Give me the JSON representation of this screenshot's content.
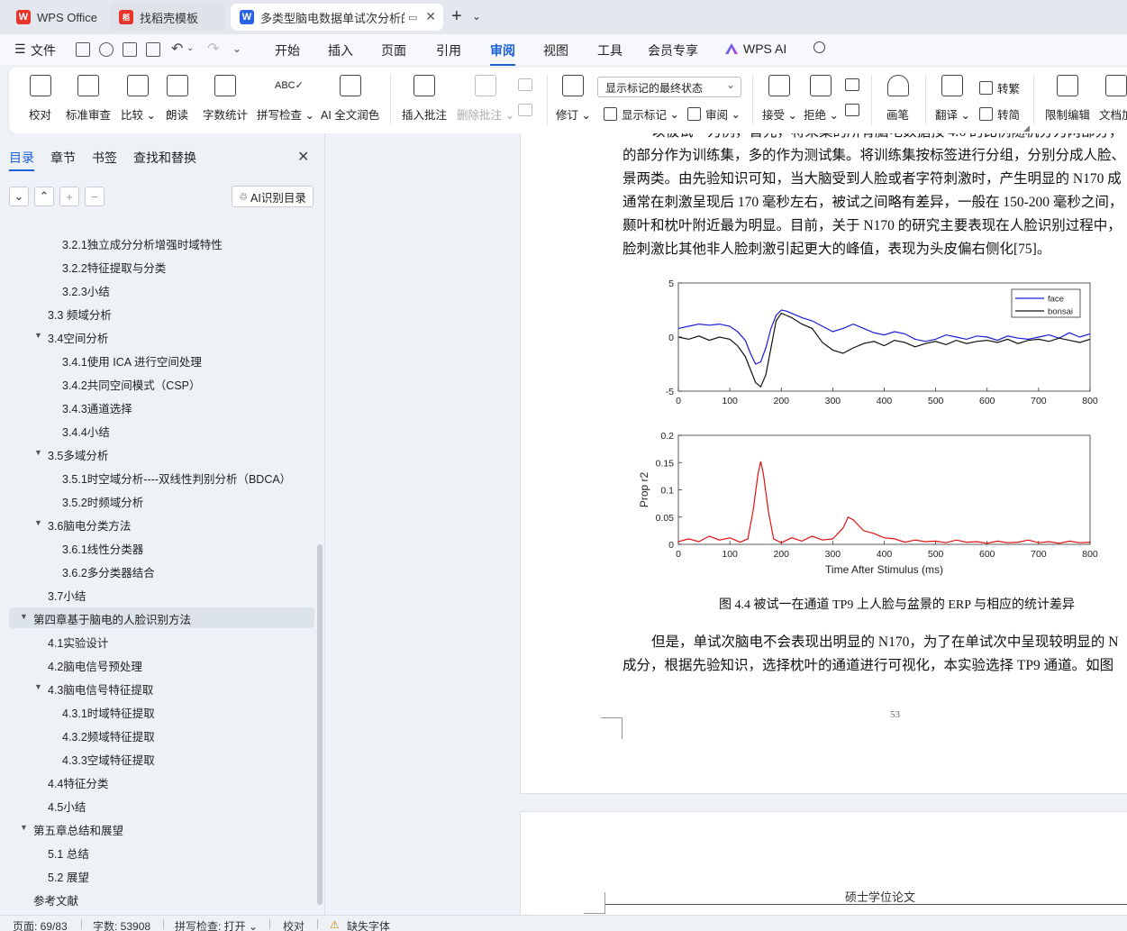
{
  "tabs": [
    {
      "label": "WPS Office",
      "logo": "W"
    },
    {
      "label": "找稻壳模板",
      "logo": "稻"
    },
    {
      "label": "多类型脑电数据单试次分析的",
      "logo": "W"
    }
  ],
  "menubar": {
    "file_label": "文件",
    "items": [
      "开始",
      "插入",
      "页面",
      "引用",
      "审阅",
      "视图",
      "工具",
      "会员专享",
      "WPS AI"
    ]
  },
  "ribbon": {
    "proofread": "校对",
    "standard_review": "标准审查",
    "compare": "比较",
    "read_aloud": "朗读",
    "word_count": "字数统计",
    "spell_check": "拼写检查",
    "ai_polish": "AI 全文润色",
    "insert_comment": "插入批注",
    "delete_comment": "删除批注",
    "track_changes": "修订",
    "markup_display_select": "显示标记的最终状态",
    "show_markup": "显示标记",
    "review": "审阅",
    "accept": "接受",
    "reject": "拒绝",
    "pen": "画笔",
    "translate": "翻译",
    "to_traditional": "转繁",
    "to_simplified": "转简",
    "restrict_edit": "限制编辑",
    "doc_encrypt": "文档加"
  },
  "sidebar": {
    "tabs": [
      "目录",
      "章节",
      "书签",
      "查找和替换"
    ],
    "ai_toc_label": "AI识别目录",
    "toc_items": [
      {
        "label": "3.2.1独立成分分析增强时域特性",
        "level": 3,
        "tri": ""
      },
      {
        "label": "3.2.2特征提取与分类",
        "level": 3,
        "tri": ""
      },
      {
        "label": "3.2.3小结",
        "level": 3,
        "tri": ""
      },
      {
        "label": "3.3  频域分析",
        "level": 2,
        "tri": ""
      },
      {
        "label": "3.4空间分析",
        "level": 2,
        "tri": "▼"
      },
      {
        "label": "3.4.1使用 ICA 进行空间处理",
        "level": 3,
        "tri": ""
      },
      {
        "label": "3.4.2共同空间模式（CSP）",
        "level": 3,
        "tri": ""
      },
      {
        "label": "3.4.3通道选择",
        "level": 3,
        "tri": ""
      },
      {
        "label": "3.4.4小结",
        "level": 3,
        "tri": ""
      },
      {
        "label": "3.5多域分析",
        "level": 2,
        "tri": "▼"
      },
      {
        "label": "3.5.1时空域分析----双线性判别分析（BDCA）",
        "level": 3,
        "tri": ""
      },
      {
        "label": "3.5.2时频域分析",
        "level": 3,
        "tri": ""
      },
      {
        "label": "3.6脑电分类方法",
        "level": 2,
        "tri": "▼"
      },
      {
        "label": "3.6.1线性分类器",
        "level": 3,
        "tri": ""
      },
      {
        "label": "3.6.2多分类器结合",
        "level": 3,
        "tri": ""
      },
      {
        "label": "3.7小结",
        "level": 2,
        "tri": ""
      },
      {
        "label": "第四章基于脑电的人脸识别方法",
        "level": 1,
        "tri": "▼"
      },
      {
        "label": "4.1实验设计",
        "level": 2,
        "tri": ""
      },
      {
        "label": "4.2脑电信号预处理",
        "level": 2,
        "tri": ""
      },
      {
        "label": "4.3脑电信号特征提取",
        "level": 2,
        "tri": "▼"
      },
      {
        "label": "4.3.1时域特征提取",
        "level": 3,
        "tri": ""
      },
      {
        "label": "4.3.2频域特征提取",
        "level": 3,
        "tri": ""
      },
      {
        "label": "4.3.3空域特征提取",
        "level": 3,
        "tri": ""
      },
      {
        "label": "4.4特征分类",
        "level": 2,
        "tri": ""
      },
      {
        "label": "4.5小结",
        "level": 2,
        "tri": ""
      },
      {
        "label": "第五章总结和展望",
        "level": 1,
        "tri": "▼"
      },
      {
        "label": "5.1  总结",
        "level": 2,
        "tri": ""
      },
      {
        "label": "5.2  展望",
        "level": 2,
        "tri": ""
      },
      {
        "label": "参考文献",
        "level": 1,
        "tri": ""
      }
    ]
  },
  "document": {
    "para1_lines": [
      "以被试一为例，首先，将采集的所有脑电数据按 4:6 的比例随机分为两部分，",
      "的部分作为训练集，多的作为测试集。将训练集按标签进行分组，分别分成人脸、",
      "景两类。由先验知识可知，当大脑受到人脸或者字符刺激时，产生明显的 N170 成",
      "通常在刺激呈现后 170 毫秒左右，被试之间略有差异，一般在 150-200 毫秒之间，",
      "颞叶和枕叶附近最为明显。目前，关于 N170 的研究主要表现在人脸识别过程中，",
      "脸刺激比其他非人脸刺激引起更大的峰值，表现为头皮偏右侧化[75]。"
    ],
    "caption": "图 4.4  被试一在通道 TP9 上人脸与盆景的 ERP 与相应的统计差异",
    "para2_lines": [
      "但是，单试次脑电不会表现出明显的 N170，为了在单试次中呈现较明显的 N",
      "成分，根据先验知识，选择枕叶的通道进行可视化，本实验选择 TP9 通道。如图"
    ],
    "page_number": "53",
    "next_page_header": "硕士学位论文"
  },
  "chart_data": [
    {
      "type": "line",
      "title": "",
      "xlabel": "",
      "ylabel": "",
      "xlim": [
        0,
        800
      ],
      "ylim": [
        -5,
        5
      ],
      "xticks": [
        0,
        100,
        200,
        300,
        400,
        500,
        600,
        700,
        800
      ],
      "yticks": [
        5,
        0,
        -5
      ],
      "legend_position": "top-right",
      "series": [
        {
          "name": "face",
          "color": "#1a1adb",
          "x": [
            0,
            20,
            40,
            60,
            80,
            100,
            115,
            130,
            140,
            150,
            160,
            170,
            180,
            190,
            200,
            210,
            220,
            240,
            260,
            280,
            300,
            320,
            340,
            360,
            380,
            400,
            420,
            440,
            460,
            480,
            500,
            520,
            540,
            560,
            580,
            600,
            620,
            640,
            660,
            680,
            700,
            720,
            740,
            760,
            780,
            800
          ],
          "y": [
            0.8,
            1.0,
            1.2,
            1.1,
            1.2,
            1.0,
            0.5,
            -0.3,
            -1.5,
            -2.5,
            -2.3,
            -1.0,
            0.8,
            2.0,
            2.5,
            2.4,
            2.2,
            1.8,
            1.5,
            1.0,
            0.5,
            0.8,
            1.2,
            0.8,
            0.4,
            0.2,
            0.5,
            0.3,
            -0.2,
            -0.4,
            -0.2,
            0.2,
            0.0,
            -0.2,
            0.1,
            0.0,
            -0.3,
            0.1,
            -0.1,
            -0.2,
            0.0,
            0.2,
            -0.1,
            0.4,
            0.0,
            0.3
          ]
        },
        {
          "name": "bonsai",
          "color": "#111111",
          "x": [
            0,
            20,
            40,
            60,
            80,
            100,
            115,
            130,
            140,
            150,
            160,
            170,
            180,
            190,
            200,
            210,
            220,
            240,
            260,
            280,
            300,
            320,
            340,
            360,
            380,
            400,
            420,
            440,
            460,
            480,
            500,
            520,
            540,
            560,
            580,
            600,
            620,
            640,
            660,
            680,
            700,
            720,
            740,
            760,
            780,
            800
          ],
          "y": [
            0.0,
            -0.2,
            0.1,
            -0.3,
            0.0,
            -0.2,
            -0.8,
            -1.8,
            -3.0,
            -4.2,
            -4.6,
            -3.5,
            -1.0,
            1.5,
            2.2,
            2.0,
            1.8,
            1.2,
            0.8,
            -0.5,
            -1.2,
            -1.5,
            -1.0,
            -0.6,
            -0.4,
            -0.8,
            -0.3,
            -0.5,
            -0.9,
            -0.6,
            -0.4,
            -0.7,
            -0.3,
            -0.6,
            -0.4,
            -0.3,
            -0.5,
            -0.2,
            -0.6,
            -0.3,
            -0.2,
            -0.4,
            -0.1,
            -0.3,
            -0.5,
            -0.2
          ]
        }
      ]
    },
    {
      "type": "line",
      "title": "",
      "xlabel": "Time After Stimulus (ms)",
      "ylabel": "Prop r2",
      "xlim": [
        0,
        800
      ],
      "ylim": [
        0,
        0.2
      ],
      "xticks": [
        0,
        100,
        200,
        300,
        400,
        500,
        600,
        700,
        800
      ],
      "yticks": [
        0.2,
        0.15,
        0.1,
        0.05,
        0
      ],
      "series": [
        {
          "color": "#e01010",
          "x": [
            0,
            20,
            40,
            60,
            80,
            100,
            120,
            135,
            145,
            155,
            160,
            165,
            175,
            185,
            200,
            220,
            240,
            260,
            280,
            300,
            320,
            330,
            340,
            360,
            380,
            400,
            420,
            440,
            460,
            480,
            500,
            520,
            540,
            560,
            580,
            600,
            620,
            640,
            660,
            680,
            700,
            720,
            740,
            760,
            780,
            800
          ],
          "y": [
            0.005,
            0.01,
            0.005,
            0.015,
            0.008,
            0.012,
            0.004,
            0.01,
            0.06,
            0.13,
            0.152,
            0.13,
            0.06,
            0.01,
            0.003,
            0.012,
            0.006,
            0.015,
            0.008,
            0.01,
            0.03,
            0.05,
            0.045,
            0.025,
            0.02,
            0.012,
            0.01,
            0.004,
            0.008,
            0.005,
            0.006,
            0.003,
            0.008,
            0.004,
            0.005,
            0.002,
            0.006,
            0.003,
            0.004,
            0.008,
            0.003,
            0.005,
            0.002,
            0.006,
            0.003,
            0.004
          ]
        }
      ]
    }
  ],
  "statusbar": {
    "page": "页面: 69/83",
    "words": "字数: 53908",
    "spell": "拼写检查: 打开",
    "proof": "校对",
    "missing_font": "缺失字体"
  },
  "colors": {
    "accent": "#1a5fd6",
    "wps_red": "#e8352b"
  }
}
